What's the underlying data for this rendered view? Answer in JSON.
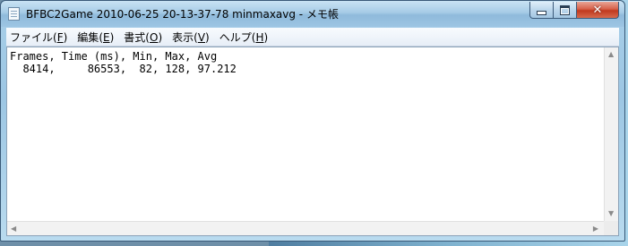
{
  "window": {
    "title": "BFBC2Game 2010-06-25 20-13-37-78 minmaxavg - メモ帳",
    "controls": {
      "close": "✕"
    }
  },
  "menu": [
    {
      "label": "ファイル",
      "key": "F"
    },
    {
      "label": "編集",
      "key": "E"
    },
    {
      "label": "書式",
      "key": "O"
    },
    {
      "label": "表示",
      "key": "V"
    },
    {
      "label": "ヘルプ",
      "key": "H"
    }
  ],
  "document": {
    "lines": [
      "Frames, Time (ms), Min, Max, Avg",
      "  8414,     86553,  82, 128, 97.212"
    ]
  },
  "scrollbars": {
    "up": "▲",
    "down": "▼",
    "left": "◀",
    "right": "▶"
  }
}
